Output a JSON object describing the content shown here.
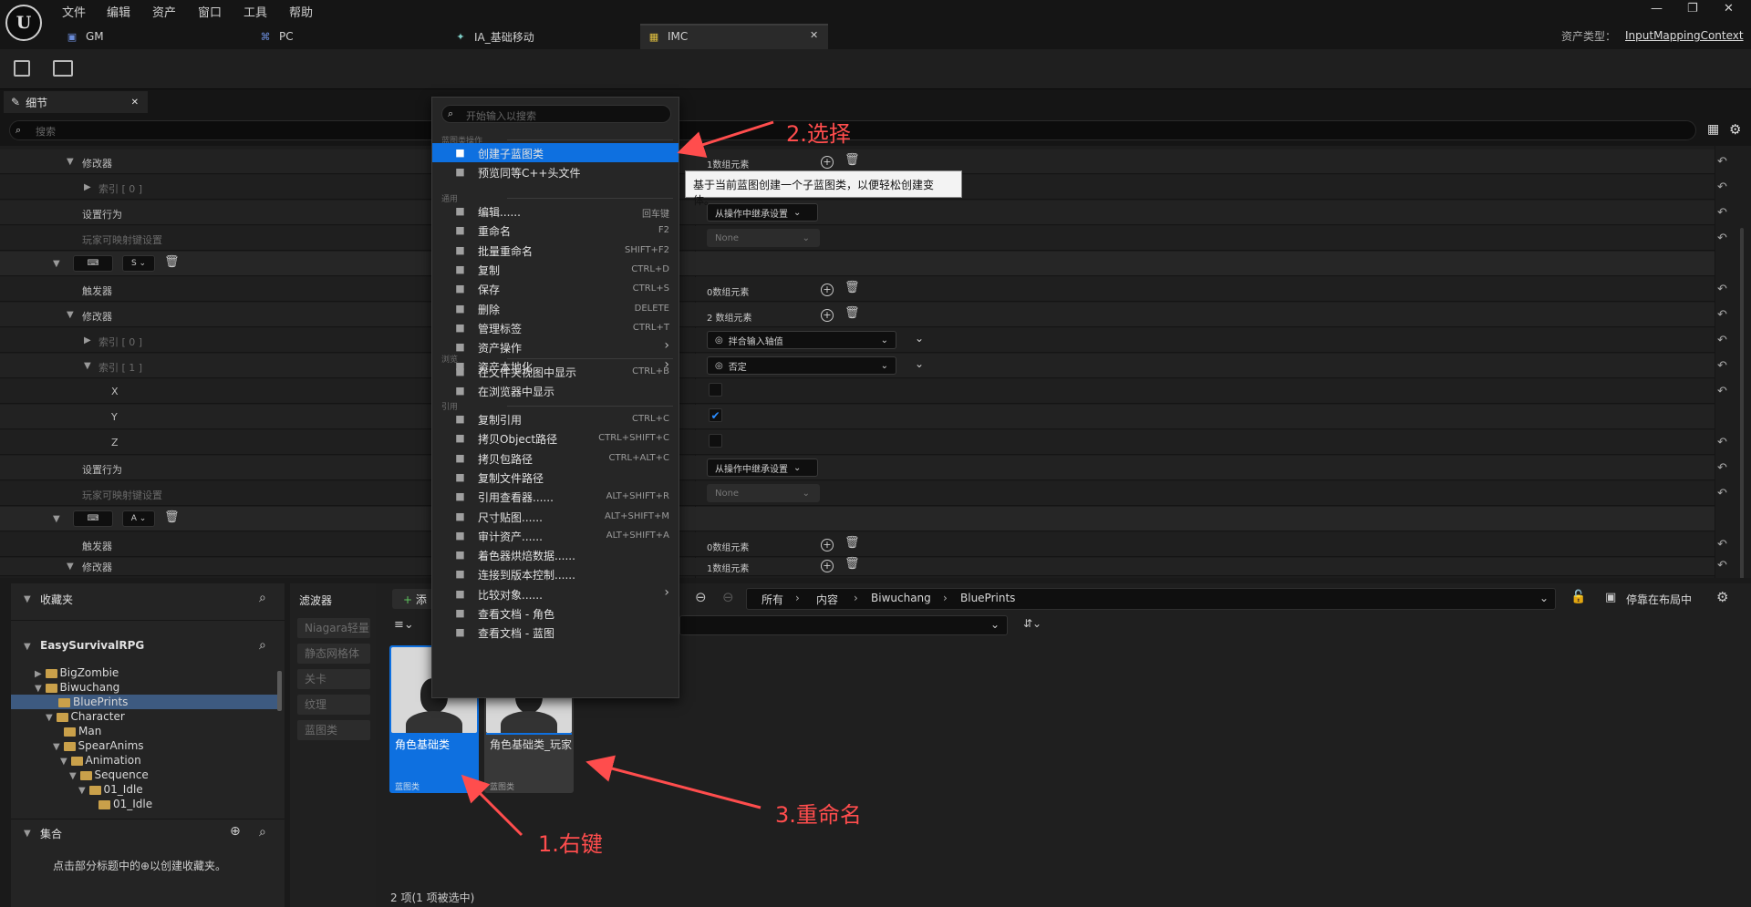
{
  "menu": [
    "文件",
    "编辑",
    "资产",
    "窗口",
    "工具",
    "帮助"
  ],
  "tabs": [
    {
      "label": "GM",
      "icon": "blueprint-icon"
    },
    {
      "label": "PC",
      "icon": "gamepad-icon"
    },
    {
      "label": "IA_基础移动",
      "icon": "input-action-icon"
    },
    {
      "label": "IMC",
      "icon": "input-mapping-icon",
      "active": true
    }
  ],
  "asset_type": {
    "label": "资产类型：",
    "value": "InputMappingContext"
  },
  "details": {
    "tab_label": "细节",
    "search_placeholder": "搜索",
    "rows": {
      "modifiers": "修改器",
      "index0": "索引 [ 0 ]",
      "index1": "索引 [ 1 ]",
      "set_behavior": "设置行为",
      "player_mappable": "玩家可映射键设置",
      "triggers": "触发器",
      "x": "X",
      "y": "Y",
      "z": "Z",
      "key_s": "S",
      "key_a": "A",
      "one_elem": "1数组元素",
      "zero_elem": "0数组元素",
      "two_elem": "2 数组元素",
      "inherit": "从操作中继承设置",
      "none": "None",
      "swizzle": "拌合输入轴值",
      "negate": "否定"
    }
  },
  "context_menu": {
    "search_placeholder": "开始输入以搜索",
    "sections": {
      "blueprint": "蓝图类操作",
      "common": "通用",
      "explore": "浏览",
      "references": "引用"
    },
    "items": [
      {
        "label": "创建子蓝图类",
        "shortcut": "",
        "icon": "blueprint-child-icon",
        "selected": true
      },
      {
        "label": "预览同等C++头文件",
        "shortcut": "",
        "icon": "preview-icon"
      },
      {
        "label": "编辑......",
        "shortcut": "回车键",
        "icon": "pencil-icon"
      },
      {
        "label": "重命名",
        "shortcut": "F2",
        "icon": "rename-icon"
      },
      {
        "label": "批量重命名",
        "shortcut": "SHIFT+F2",
        "icon": "batch-rename-icon"
      },
      {
        "label": "复制",
        "shortcut": "CTRL+D",
        "icon": "duplicate-icon"
      },
      {
        "label": "保存",
        "shortcut": "CTRL+S",
        "icon": "save-icon"
      },
      {
        "label": "删除",
        "shortcut": "DELETE",
        "icon": "delete-icon"
      },
      {
        "label": "管理标签",
        "shortcut": "CTRL+T",
        "icon": "tag-icon"
      },
      {
        "label": "资产操作",
        "shortcut": "",
        "icon": "wrench-icon",
        "submenu": true
      },
      {
        "label": "资产本地化",
        "shortcut": "",
        "icon": "flag-icon",
        "submenu": true
      },
      {
        "label": "在文件夹视图中显示",
        "shortcut": "CTRL+B",
        "icon": "folder-view-icon"
      },
      {
        "label": "在浏览器中显示",
        "shortcut": "",
        "icon": "browser-icon"
      },
      {
        "label": "复制引用",
        "shortcut": "CTRL+C",
        "icon": "copy-ref-icon"
      },
      {
        "label": "拷贝Object路径",
        "shortcut": "CTRL+SHIFT+C",
        "icon": "copy-path-icon"
      },
      {
        "label": "拷贝包路径",
        "shortcut": "CTRL+ALT+C",
        "icon": "copy-package-icon"
      },
      {
        "label": "复制文件路径",
        "shortcut": "",
        "icon": "copy-file-icon"
      },
      {
        "label": "引用查看器......",
        "shortcut": "ALT+SHIFT+R",
        "icon": "reference-viewer-icon"
      },
      {
        "label": "尺寸贴图......",
        "shortcut": "ALT+SHIFT+M",
        "icon": "size-map-icon"
      },
      {
        "label": "审计资产......",
        "shortcut": "ALT+SHIFT+A",
        "icon": "audit-icon"
      },
      {
        "label": "着色器烘焙数据......",
        "shortcut": "",
        "icon": "shader-icon"
      },
      {
        "label": "连接到版本控制......",
        "shortcut": "",
        "icon": "source-control-icon"
      },
      {
        "label": "比较对象......",
        "shortcut": "",
        "icon": "compare-icon",
        "submenu": true
      },
      {
        "label": "查看文档 - 角色",
        "shortcut": "",
        "icon": "doc-icon"
      },
      {
        "label": "查看文档 - 蓝图",
        "shortcut": "",
        "icon": "doc-icon"
      }
    ]
  },
  "tooltip": "基于当前蓝图创建一个子蓝图类，以便轻松创建变体。",
  "content_browser": {
    "favorites": "收藏夹",
    "project": "EasySurvivalRPG",
    "tree": [
      {
        "label": "BigZombie",
        "depth": 0
      },
      {
        "label": "Biwuchang",
        "depth": 0
      },
      {
        "label": "BluePrints",
        "depth": 1,
        "selected": true
      },
      {
        "label": "Character",
        "depth": 1
      },
      {
        "label": "Man",
        "depth": 2
      },
      {
        "label": "SpearAnims",
        "depth": 2
      },
      {
        "label": "Animation",
        "depth": 3
      },
      {
        "label": "Sequence",
        "depth": 4
      },
      {
        "label": "01_Idle",
        "depth": 5
      },
      {
        "label": "01_Idle",
        "depth": 6
      }
    ],
    "collections": "集合",
    "collections_hint": "点击部分标题中的⊕以创建收藏夹。",
    "filters_title": "滤波器",
    "filters": [
      "Niagara轻量",
      "静态网格体",
      "关卡",
      "纹理",
      "蓝图类"
    ],
    "add_label": "添",
    "breadcrumb": [
      "所有",
      "内容",
      "Biwuchang",
      "BluePrints"
    ],
    "dock_label": "停靠在布局中",
    "assets": [
      {
        "name": "角色基础类",
        "type": "蓝图类",
        "selected": true
      },
      {
        "name": "角色基础类_玩家",
        "type": "蓝图类",
        "selected": false
      }
    ],
    "status": "2 项(1 项被选中)"
  },
  "annotations": {
    "step1": "1.右键",
    "step2": "2.选择",
    "step3": "3.重命名"
  },
  "colors": {
    "accent": "#0e70e0",
    "annotation": "#ff4d4d",
    "folder": "#c9a04a"
  }
}
